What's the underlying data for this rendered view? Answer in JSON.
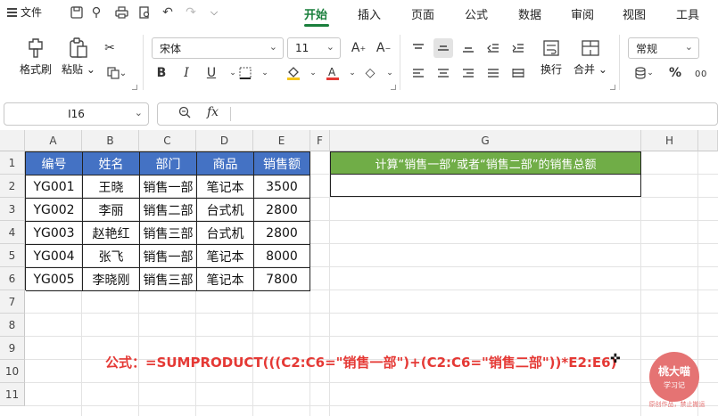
{
  "menubar": {
    "file_label": "文件",
    "tabs": [
      "开始",
      "插入",
      "页面",
      "公式",
      "数据",
      "审阅",
      "视图",
      "工具"
    ],
    "active_tab": "开始"
  },
  "ribbon": {
    "format_painter": "格式刷",
    "paste": "粘贴",
    "font_name": "宋体",
    "font_size": "11",
    "wrap": "换行",
    "merge": "合并",
    "number_format": "常规",
    "bold": "B",
    "italic": "I",
    "underline": "U",
    "percent": "%"
  },
  "formula_bar": {
    "cell_ref": "I16",
    "fx": "fx",
    "content": ""
  },
  "columns": [
    "A",
    "B",
    "C",
    "D",
    "E",
    "F",
    "G",
    "H"
  ],
  "rows": [
    "1",
    "2",
    "3",
    "4",
    "5",
    "6",
    "7",
    "8",
    "9",
    "10",
    "11"
  ],
  "table": {
    "headers": [
      "编号",
      "姓名",
      "部门",
      "商品",
      "销售额"
    ],
    "rows": [
      [
        "YG001",
        "王晓",
        "销售一部",
        "笔记本",
        "3500"
      ],
      [
        "YG002",
        "李丽",
        "销售二部",
        "台式机",
        "2800"
      ],
      [
        "YG003",
        "赵艳红",
        "销售三部",
        "台式机",
        "2800"
      ],
      [
        "YG004",
        "张飞",
        "销售一部",
        "笔记本",
        "8000"
      ],
      [
        "YG005",
        "李晓刚",
        "销售三部",
        "笔记本",
        "7800"
      ]
    ]
  },
  "question": "计算“销售一部”或者“销售二部”的销售总额",
  "answer": "",
  "formula_note": "公式：=SUMPRODUCT(((C2:C6=\"销售一部\")+(C2:C6=\"销售二部\"))*E2:E6)",
  "watermark": {
    "title": "桃大喵",
    "subtitle": "学习记",
    "note": "原创作品，禁止搬运"
  },
  "colors": {
    "accent": "#1a7f3c",
    "table_header": "#4472c4",
    "question_header": "#70ad47",
    "formula_text": "#e53935",
    "watermark": "#e57373"
  }
}
